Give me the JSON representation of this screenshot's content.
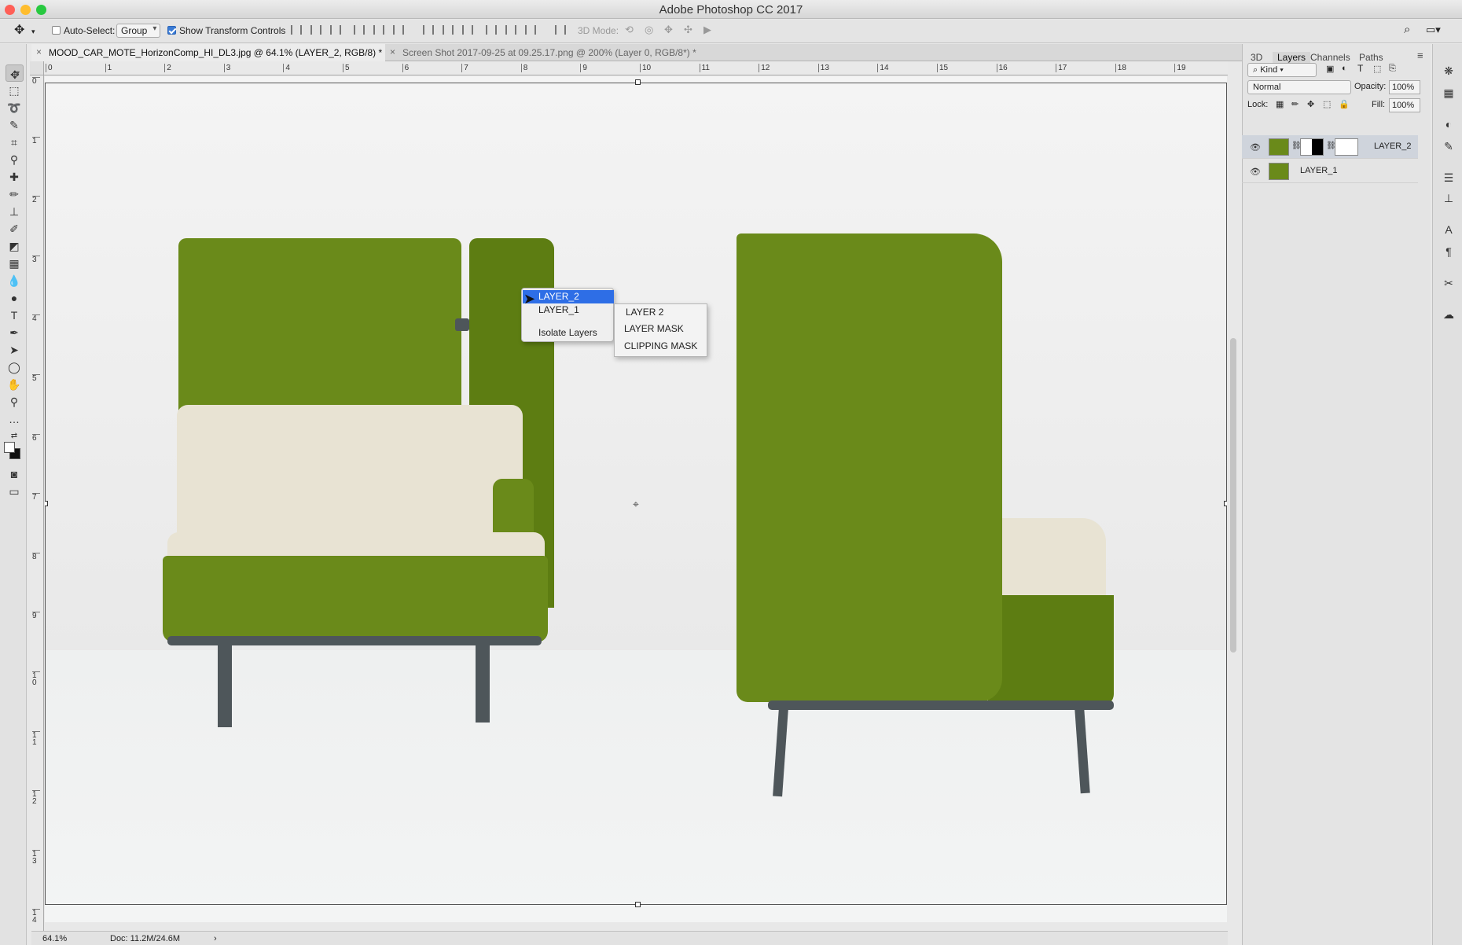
{
  "app": {
    "title": "Adobe Photoshop CC 2017"
  },
  "traffic_lights": {
    "close": "#ff5f57",
    "minimize": "#ffbd2e",
    "zoom": "#28c940"
  },
  "options": {
    "auto_select_label": "Auto-Select:",
    "auto_select_checked": false,
    "auto_select_value": "Group",
    "show_transform_label": "Show Transform Controls",
    "show_transform_checked": true,
    "mode_3d_label": "3D Mode:"
  },
  "tabs": [
    {
      "label": "MOOD_CAR_MOTE_HorizonComp_HI_DL3.jpg @ 64.1% (LAYER_2, RGB/8) *",
      "active": true
    },
    {
      "label": "Screen Shot 2017-09-25 at 09.25.17.png @ 200% (Layer 0, RGB/8*) *",
      "active": false
    }
  ],
  "ruler": {
    "h_ticks": [
      "0",
      "1",
      "2",
      "3",
      "4",
      "5",
      "6",
      "7",
      "8",
      "9",
      "10",
      "11",
      "12",
      "13",
      "14",
      "15",
      "16",
      "17",
      "18",
      "19"
    ],
    "v_ticks": [
      "0",
      "1",
      "2",
      "3",
      "4",
      "5",
      "6",
      "7",
      "8",
      "9",
      "1 0",
      "1 1",
      "1 2",
      "1 3",
      "1 4"
    ]
  },
  "context_menu": {
    "items": [
      {
        "label": "LAYER_2",
        "highlighted": true
      },
      {
        "label": "LAYER_1",
        "highlighted": false
      },
      {
        "label": "Isolate Layers",
        "highlighted": false
      }
    ]
  },
  "submenu": {
    "items": [
      "LAYER 2",
      "LAYER MASK",
      "CLIPPING MASK"
    ]
  },
  "status": {
    "zoom": "64.1%",
    "doc": "Doc: 11.2M/24.6M",
    "arrow": "›"
  },
  "panel": {
    "tabs": [
      "3D",
      "Layers",
      "Channels",
      "Paths"
    ],
    "active_tab": "Layers",
    "filter_kind": "Kind",
    "blend_mode": "Normal",
    "opacity_label": "Opacity:",
    "opacity_value": "100%",
    "lock_label": "Lock:",
    "fill_label": "Fill:",
    "fill_value": "100%",
    "layers": [
      {
        "name": "LAYER_2",
        "selected": true,
        "visible": true,
        "has_mask": true
      },
      {
        "name": "LAYER_1",
        "selected": false,
        "visible": true,
        "has_mask": false
      }
    ]
  },
  "colors": {
    "accent": "#2e6ee6",
    "sofa_green": "#6a8a1a",
    "sofa_cream": "#e8e3d3"
  }
}
